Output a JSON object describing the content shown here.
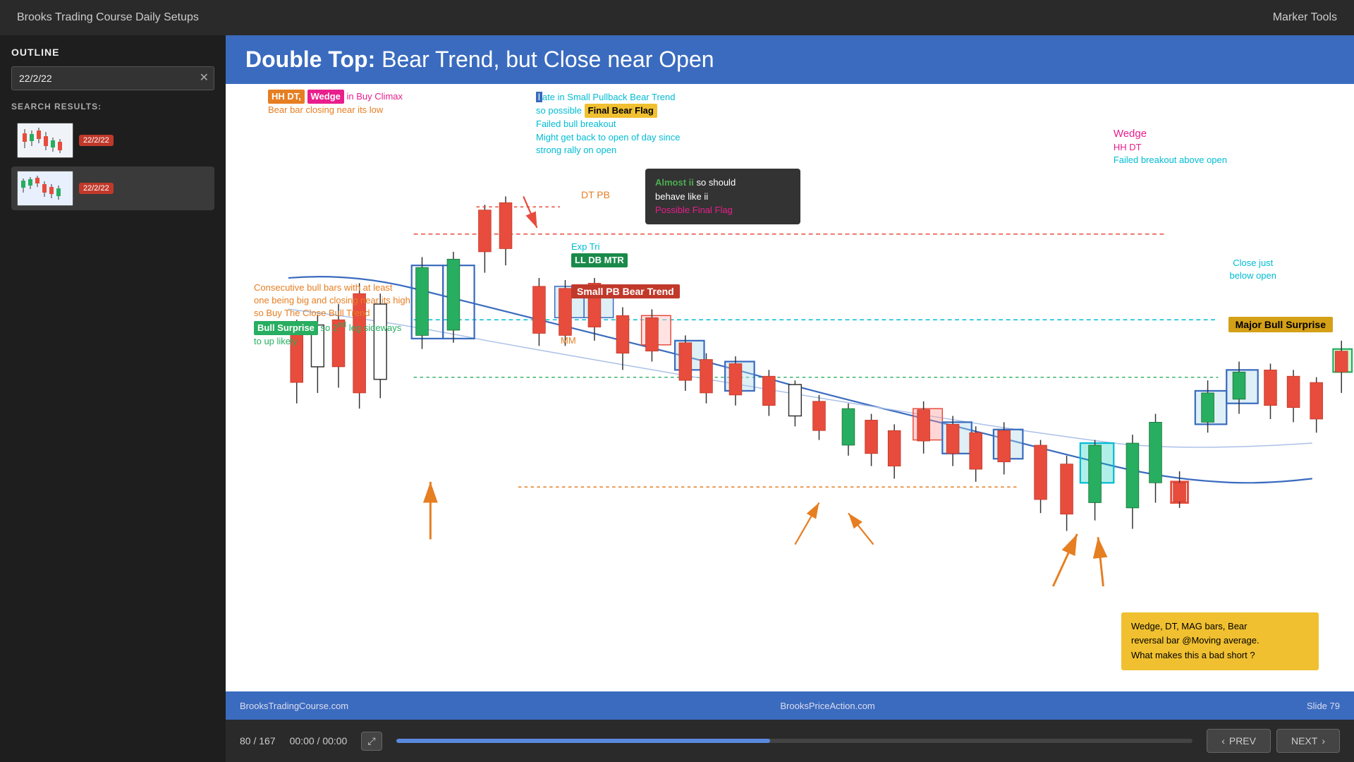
{
  "topBar": {
    "title": "Brooks Trading Course Daily Setups",
    "markerTools": "Marker Tools"
  },
  "sidebar": {
    "outlineLabel": "OUTLINE",
    "searchValue": "22/2/22",
    "searchResultsLabel": "SEARCH RESULTS:",
    "results": [
      {
        "date": "22/2/22",
        "active": false
      },
      {
        "date": "22/2/22",
        "active": true
      }
    ]
  },
  "slide": {
    "titleBold": "Double Top:",
    "titleNormal": " Bear Trend, but Close near Open",
    "annotations": {
      "hhDtWedge": "HH DT, Wedge",
      "inBuyClimax": "in Buy Climax",
      "bearBarClosing": "Bear bar closing near its low",
      "lateInSmall": "late in Small Pullback Bear Trend",
      "soPossible": "so possible",
      "finalBearFlag": "Final Bear Flag",
      "failedBullBreakout": "Failed bull breakout",
      "mightGetBack": "Might get back to open of day since",
      "strongRallyOnOpen": "strong rally on open",
      "almostII": "Almost ii",
      "soShouldBehave": "so should behave like ii",
      "possibleFinalFlag": "Possible Final Flag",
      "wedge": "Wedge",
      "hhDt": "HH DT",
      "failedBreakoutAboveOpen": "Failed breakout above open",
      "dtPb": "DT PB",
      "expTri": "Exp Tri",
      "llDbMtr": "LL DB MTR",
      "smallPbBearTrend": "Small PB Bear Trend",
      "consecutiveBullBars": "Consecutive bull bars with at least\none being big and closing near its high\nso Buy The Close Bull Trend",
      "bullSurprise": "Bull Surprise",
      "soSecondLeg": "so 2nd leg sideways\nto up likely",
      "mm": "MM",
      "closeJustBelowOpen": "Close just\nbelow open",
      "majorBullSurprise": "Major Bull Surprise",
      "wedgeDtMag": "Wedge, DT, MAG bars, Bear\nreversal bar @Moving average.\nWhat makes this a bad short ?"
    },
    "footer": {
      "left": "BrooksTradingCourse.com",
      "center": "BrooksPriceAction.com",
      "slideNumber": "Slide  79"
    }
  },
  "bottomControls": {
    "pageIndicator": "80 / 167",
    "timeIndicator": "00:00 / 00:00",
    "expandIcon": "⤢",
    "progressPercent": 47,
    "prevLabel": "PREV",
    "nextLabel": "NEXT"
  }
}
